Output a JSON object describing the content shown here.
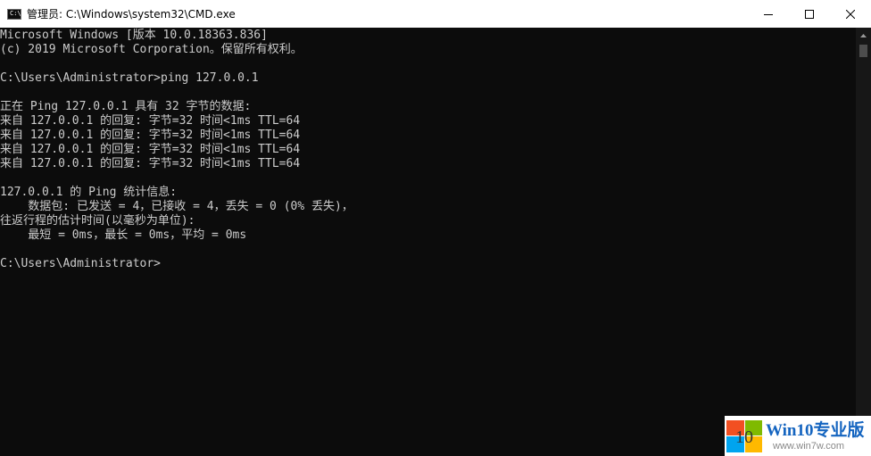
{
  "window": {
    "title": "管理员: C:\\Windows\\system32\\CMD.exe",
    "icon": "console-icon",
    "icon_glyph": "C:\\",
    "controls": {
      "minimize": "minimize-icon",
      "maximize": "maximize-icon",
      "close": "close-icon"
    }
  },
  "console": {
    "lines": [
      "Microsoft Windows [版本 10.0.18363.836]",
      "(c) 2019 Microsoft Corporation。保留所有权利。",
      "",
      "C:\\Users\\Administrator>ping 127.0.0.1",
      "",
      "正在 Ping 127.0.0.1 具有 32 字节的数据:",
      "来自 127.0.0.1 的回复: 字节=32 时间<1ms TTL=64",
      "来自 127.0.0.1 的回复: 字节=32 时间<1ms TTL=64",
      "来自 127.0.0.1 的回复: 字节=32 时间<1ms TTL=64",
      "来自 127.0.0.1 的回复: 字节=32 时间<1ms TTL=64",
      "",
      "127.0.0.1 的 Ping 统计信息:",
      "    数据包: 已发送 = 4，已接收 = 4，丢失 = 0 (0% 丢失)，",
      "往返行程的估计时间(以毫秒为单位):",
      "    最短 = 0ms，最长 = 0ms，平均 = 0ms",
      "",
      "C:\\Users\\Administrator>"
    ]
  },
  "watermark": {
    "logo_number": "10",
    "brand": "Win10专业版",
    "url": "www.win7w.com"
  },
  "colors": {
    "console_background": "#0c0c0c",
    "console_text": "#cccccc",
    "titlebar_background": "#ffffff",
    "watermark_brand": "#1565c0"
  }
}
